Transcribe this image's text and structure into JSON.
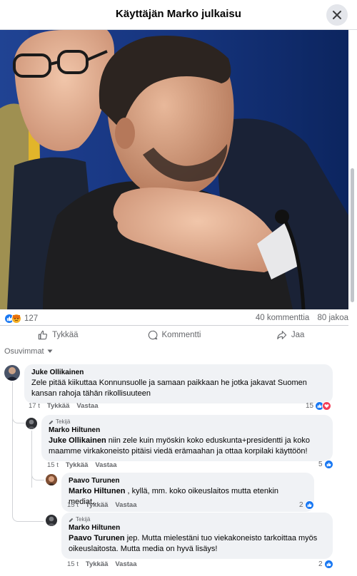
{
  "header": {
    "title": "Käyttäjän Marko julkaisu"
  },
  "post": {
    "reaction_count": "127",
    "comments_count": "40 kommenttia",
    "shares_count": "80 jakoa",
    "actions": {
      "like": "Tykkää",
      "comment": "Kommentti",
      "share": "Jaa"
    },
    "sort_label": "Osuvimmat"
  },
  "comments": [
    {
      "author": "Juke Ollikainen",
      "text_lines": [
        "Zele pitää kiikuttaa Konnunsuolle ja samaan paikkaan he jotka jakavat Suomen",
        "kansan rahoja tähän rikollisuuteen"
      ],
      "time": "17 t",
      "like": "Tykkää",
      "reply": "Vastaa",
      "reactions": "15"
    },
    {
      "badge": "Tekijä",
      "author": "Marko Hiltunen",
      "mention": "Juke Ollikainen",
      "text_lines": [
        " niin zele kuin myöskin koko eduskunta+presidentti ja koko",
        "maamme virkakoneisto pitäisi viedä erämaahan ja ottaa korpilaki käyttöön!"
      ],
      "time": "15 t",
      "like": "Tykkää",
      "reply": "Vastaa",
      "reactions": "5"
    },
    {
      "author": "Paavo Turunen",
      "mention": "Marko Hiltunen",
      "text": " , kyllä, mm. koko oikeuslaitos mutta etenkin mediat...",
      "time": "15 t",
      "like": "Tykkää",
      "reply": "Vastaa",
      "reactions": "2"
    },
    {
      "badge": "Tekijä",
      "author": "Marko Hiltunen",
      "mention": "Paavo Turunen",
      "text_lines": [
        " jep. Mutta mielestäni tuo viekakoneisto tarkoittaa myös",
        "oikeuslaitosta. Mutta media on hyvä lisäys!"
      ],
      "time": "15 t",
      "like": "Tykkää",
      "reply": "Vastaa",
      "reactions": "2"
    }
  ],
  "colors": {
    "like_blue": "#1877f2",
    "angry_orange": "#f7b125",
    "love_red": "#f33e58",
    "bubble_bg": "#f0f2f5",
    "muted_text": "#65676b"
  },
  "icons": [
    "close-icon",
    "like-icon",
    "comment-icon",
    "share-icon",
    "chevron-down-icon",
    "pencil-icon",
    "thumbs-up-icon",
    "angry-face-icon",
    "heart-icon"
  ]
}
